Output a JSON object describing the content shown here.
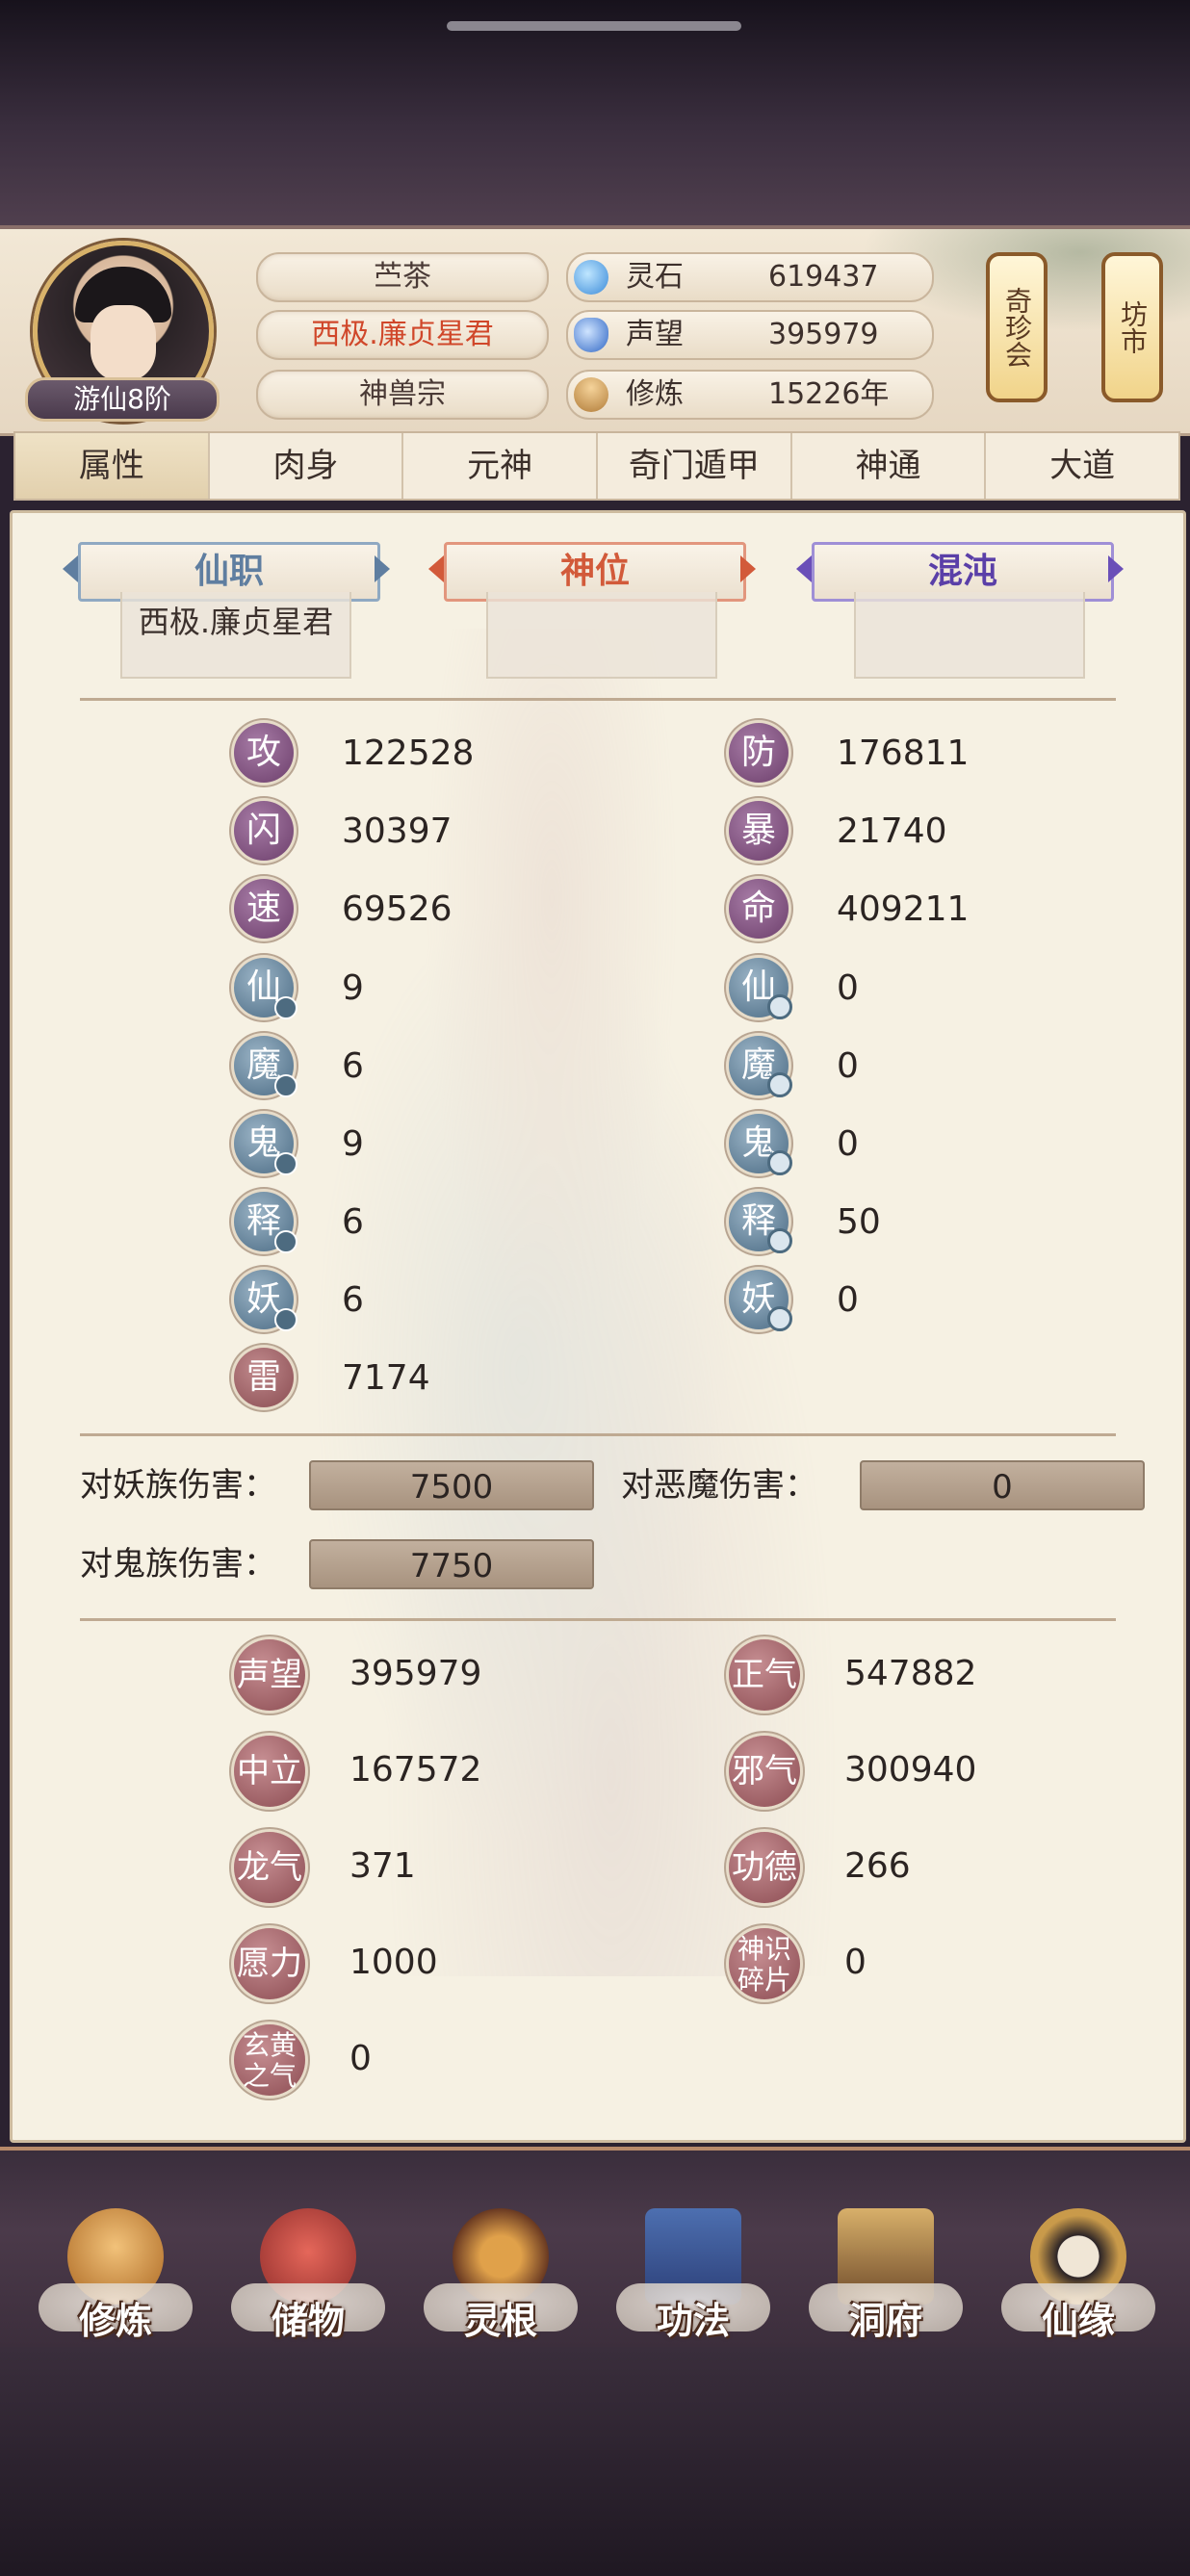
{
  "header": {
    "rank": "游仙8阶",
    "name": "苎茶",
    "title": "西极.廉贞星君",
    "sect": "神兽宗",
    "resources": [
      {
        "icon": "spirit-stone-icon",
        "label": "灵石",
        "value": "619437"
      },
      {
        "icon": "reputation-icon",
        "label": "声望",
        "value": "395979"
      },
      {
        "icon": "cultivation-icon",
        "label": "修炼",
        "value": "15226年"
      }
    ],
    "side_buttons": [
      "奇珍会",
      "坊市"
    ]
  },
  "tabs": [
    "属性",
    "肉身",
    "元神",
    "奇门遁甲",
    "神通",
    "大道"
  ],
  "active_tab": "属性",
  "positions": [
    {
      "label": "仙职",
      "value": "西极.廉贞星君",
      "color": "#5f7ea0"
    },
    {
      "label": "神位",
      "value": "",
      "color": "#d25a3a"
    },
    {
      "label": "混沌",
      "value": "",
      "color": "#6a4fb8"
    }
  ],
  "stats_left": [
    {
      "glyph": "攻",
      "value": "122528"
    },
    {
      "glyph": "闪",
      "value": "30397"
    },
    {
      "glyph": "速",
      "value": "69526"
    },
    {
      "glyph": "仙",
      "value": "9"
    },
    {
      "glyph": "魔",
      "value": "6"
    },
    {
      "glyph": "鬼",
      "value": "9"
    },
    {
      "glyph": "释",
      "value": "6"
    },
    {
      "glyph": "妖",
      "value": "6"
    },
    {
      "glyph": "雷",
      "value": "7174"
    }
  ],
  "stats_right": [
    {
      "glyph": "防",
      "value": "176811"
    },
    {
      "glyph": "暴",
      "value": "21740"
    },
    {
      "glyph": "命",
      "value": "409211"
    },
    {
      "glyph": "仙",
      "value": "0"
    },
    {
      "glyph": "魔",
      "value": "0"
    },
    {
      "glyph": "鬼",
      "value": "0"
    },
    {
      "glyph": "释",
      "value": "50"
    },
    {
      "glyph": "妖",
      "value": "0"
    }
  ],
  "damage": [
    {
      "label": "对妖族伤害：",
      "value": "7500"
    },
    {
      "label": "对恶魔伤害：",
      "value": "0"
    },
    {
      "label": "对鬼族伤害：",
      "value": "7750"
    }
  ],
  "extras": [
    {
      "label": "声望",
      "value": "395979"
    },
    {
      "label": "正气",
      "value": "547882"
    },
    {
      "label": "中立",
      "value": "167572"
    },
    {
      "label": "邪气",
      "value": "300940"
    },
    {
      "label": "龙气",
      "value": "371"
    },
    {
      "label": "功德",
      "value": "266"
    },
    {
      "label": "愿力",
      "value": "1000"
    },
    {
      "label": "神识碎片",
      "value": "0"
    },
    {
      "label": "玄黄之气",
      "value": "0"
    }
  ],
  "nav": [
    "修炼",
    "储物",
    "灵根",
    "功法",
    "洞府",
    "仙缘"
  ]
}
